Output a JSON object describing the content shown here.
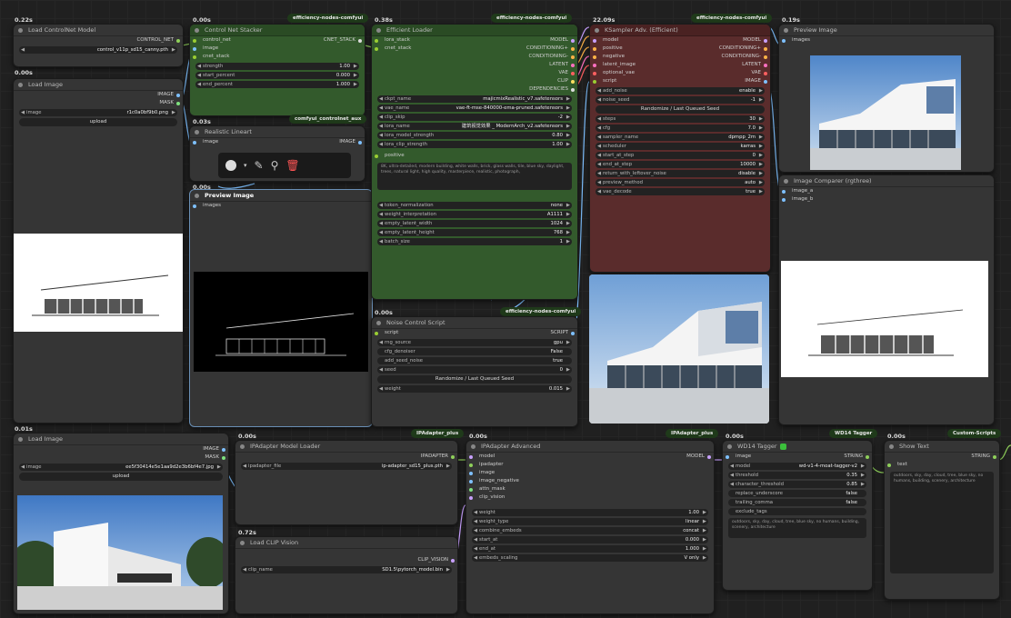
{
  "nodes": {
    "load_controlnet": {
      "time": "0.22s",
      "title": "Load ControlNet Model",
      "output": "CONTROL_NET",
      "model": "control_v11p_sd15_canny.pth"
    },
    "load_image1": {
      "time": "0.00s",
      "title": "Load Image",
      "out1": "IMAGE",
      "out2": "MASK",
      "image": "r1c0a0bf9b0.png",
      "upload": "upload"
    },
    "cn_stacker": {
      "time": "0.00s",
      "title": "Control Net Stacker",
      "badge": "efficiency-nodes-comfyui",
      "in1": "control_net",
      "in2": "image",
      "in3": "cnet_stack",
      "out": "CNET_STACK",
      "w1l": "strength",
      "w1v": "1.00",
      "w2l": "start_percent",
      "w2v": "0.000",
      "w3l": "end_percent",
      "w3v": "1.000"
    },
    "canny": {
      "time": "0.03s",
      "title": "Realistic Lineart",
      "badge": "comfyui_controlnet_aux",
      "in": "image",
      "out": "IMAGE"
    },
    "preview1": {
      "time": "0.00s",
      "title": "Preview Image",
      "in": "images"
    },
    "eff_loader": {
      "time": "0.38s",
      "title": "Efficient Loader",
      "badge": "efficiency-nodes-comfyui",
      "in1": "lora_stack",
      "in2": "cnet_stack",
      "outs": [
        "MODEL",
        "CONDITIONING+",
        "CONDITIONING-",
        "LATENT",
        "VAE",
        "CLIP",
        "DEPENDENCIES"
      ],
      "widgets": [
        {
          "l": "ckpt_name",
          "v": "majicmixRealistic_v7.safetensors"
        },
        {
          "l": "vae_name",
          "v": "vae-ft-mse-840000-ema-pruned.safetensors"
        },
        {
          "l": "clip_skip",
          "v": "-2"
        },
        {
          "l": "lora_name",
          "v": "建筑视觉效果 _ ModernArch_v2.safetensors"
        },
        {
          "l": "lora_model_strength",
          "v": "0.80"
        },
        {
          "l": "lora_clip_strength",
          "v": "1.00"
        }
      ],
      "positive": "positive",
      "prompt": "8K, ultra-detailed, modern building, white walls, brick, glass walls, tile, blue sky, daylight, trees, natural light, high quality, masterpiece, realistic, photograph,",
      "widgets2": [
        {
          "l": "token_normalization",
          "v": "none"
        },
        {
          "l": "weight_interpretation",
          "v": "A1111"
        },
        {
          "l": "empty_latent_width",
          "v": "1024"
        },
        {
          "l": "empty_latent_height",
          "v": "768"
        },
        {
          "l": "batch_size",
          "v": "1"
        }
      ]
    },
    "ksampler": {
      "time": "22.09s",
      "title": "KSampler Adv. (Efficient)",
      "badge": "efficiency-nodes-comfyui",
      "ins": [
        "model",
        "positive",
        "negative",
        "latent_image",
        "optional_vae",
        "script"
      ],
      "outs": [
        "MODEL",
        "CONDITIONING+",
        "CONDITIONING-",
        "LATENT",
        "VAE",
        "IMAGE"
      ],
      "w0": [
        {
          "l": "add_noise",
          "v": "enable"
        },
        {
          "l": "noise_seed",
          "v": "-1"
        }
      ],
      "rand": "Randomize / Last Queued Seed",
      "w1": [
        {
          "l": "steps",
          "v": "30"
        },
        {
          "l": "cfg",
          "v": "7.0"
        },
        {
          "l": "sampler_name",
          "v": "dpmpp_2m"
        },
        {
          "l": "scheduler",
          "v": "karras"
        },
        {
          "l": "start_at_step",
          "v": "0"
        },
        {
          "l": "end_at_step",
          "v": "10000"
        },
        {
          "l": "return_with_leftover_noise",
          "v": "disable"
        },
        {
          "l": "preview_method",
          "v": "auto"
        },
        {
          "l": "vae_decode",
          "v": "true"
        }
      ]
    },
    "preview2": {
      "time": "0.19s",
      "title": "Preview Image",
      "in": "images"
    },
    "compare": {
      "title": "Image Comparer (rgthree)",
      "in1": "image_a",
      "in2": "image_b"
    },
    "noise": {
      "time": "0.00s",
      "title": "Noise Control Script",
      "badge": "efficiency-nodes-comfyui",
      "in": "script",
      "out": "SCRIPT",
      "w": [
        {
          "l": "rng_source",
          "v": "gpu"
        },
        {
          "l": "cfg_denoiser",
          "v": "False"
        },
        {
          "l": "add_seed_noise",
          "v": "true"
        },
        {
          "l": "seed",
          "v": "0"
        }
      ],
      "rand": "Randomize / Last Queued Seed",
      "w2": {
        "l": "weight",
        "v": "0.015"
      }
    },
    "load_image2": {
      "time": "0.01s",
      "title": "Load Image",
      "out1": "IMAGE",
      "out2": "MASK",
      "image": "ee5f30414e5e1aa9d2e3b6bf4e7.jpg",
      "upload": "upload"
    },
    "ipa_loader": {
      "time": "0.00s",
      "title": "IPAdapter Model Loader",
      "badge": "IPAdapter_plus",
      "out": "IPADAPTER",
      "wl": "ipadapter_file",
      "wv": "ip-adapter_sd15_plus.pth"
    },
    "clip_vision": {
      "time": "0.72s",
      "title": "Load CLIP Vision",
      "out": "CLIP_VISION",
      "wl": "clip_name",
      "wv": "SD1.5\\pytorch_model.bin"
    },
    "ipa_adv": {
      "time": "0.00s",
      "title": "IPAdapter Advanced",
      "badge": "IPAdapter_plus",
      "ins": [
        "model",
        "ipadapter",
        "image",
        "image_negative",
        "attn_mask",
        "clip_vision"
      ],
      "out": "MODEL",
      "w": [
        {
          "l": "weight",
          "v": "1.00"
        },
        {
          "l": "weight_type",
          "v": "linear"
        },
        {
          "l": "combine_embeds",
          "v": "concat"
        },
        {
          "l": "start_at",
          "v": "0.000"
        },
        {
          "l": "end_at",
          "v": "1.000"
        },
        {
          "l": "embeds_scaling",
          "v": "V only"
        }
      ]
    },
    "wd14": {
      "time": "0.00s",
      "title": "WD14 Tagger",
      "badge": "WD14 Tagger",
      "in": "image",
      "out": "STRING",
      "w": [
        {
          "l": "model",
          "v": "wd-v1-4-moat-tagger-v2"
        },
        {
          "l": "threshold",
          "v": "0.35"
        },
        {
          "l": "character_threshold",
          "v": "0.85"
        },
        {
          "l": "replace_underscore",
          "v": "false"
        },
        {
          "l": "trailing_comma",
          "v": "false"
        },
        {
          "l": "exclude_tags",
          "v": ""
        }
      ],
      "text": "outdoors, sky, day, cloud, tree, blue sky, no humans, building, scenery, architecture"
    },
    "show_text": {
      "time": "0.00s",
      "title": "Show Text",
      "badge": "Custom-Scripts",
      "in": "text",
      "out": "STRING",
      "text": "outdoors, sky, day, cloud, tree, blue sky, no humans, building, scenery, architecture"
    }
  }
}
